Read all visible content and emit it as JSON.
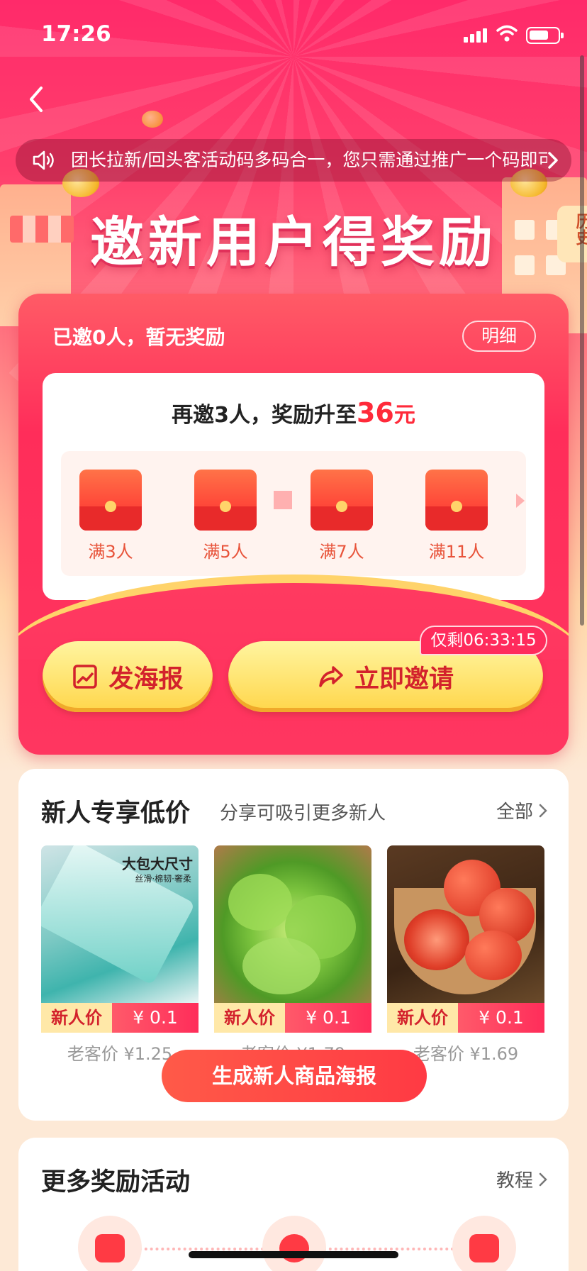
{
  "status_bar": {
    "time": "17:26"
  },
  "notice": {
    "text": "团长拉新/回头客活动码多码合一，您只需通过推广一个码即可"
  },
  "history_tab": {
    "label": "历史"
  },
  "hero": {
    "title": "邀新用户得奖励"
  },
  "reward_card": {
    "invite_status": "已邀0人，暂无奖励",
    "detail_label": "明细",
    "heading_prefix": "再邀3人，奖励升至",
    "heading_amount": "36",
    "heading_unit": "元",
    "milestones": [
      {
        "label": "满3人"
      },
      {
        "label": "满5人"
      },
      {
        "label": "满7人"
      },
      {
        "label": "满11人"
      }
    ],
    "countdown": "仅剩06:33:15",
    "poster_button_label": "发海报",
    "invite_button_label": "立即邀请"
  },
  "newuser_section": {
    "title": "新人专享低价",
    "subtitle": "分享可吸引更多新人",
    "see_all_label": "全部",
    "products": [
      {
        "tag": "新人价",
        "price": "¥ 0.1",
        "old_price": "老客价 ¥1.25",
        "image_text": "大包大尺寸",
        "image_subtext": "丝滑·棉韧·奢柔"
      },
      {
        "tag": "新人价",
        "price": "¥ 0.1",
        "old_price": "老客价 ¥1.79"
      },
      {
        "tag": "新人价",
        "price": "¥ 0.1",
        "old_price": "老客价 ¥1.69"
      }
    ],
    "generate_poster_label": "生成新人商品海报"
  },
  "more_section": {
    "title": "更多奖励活动",
    "tutorial_label": "教程"
  },
  "colors": {
    "accent": "#ff2d5a",
    "price_red": "#d3222c",
    "gold": "#ffd64a"
  }
}
